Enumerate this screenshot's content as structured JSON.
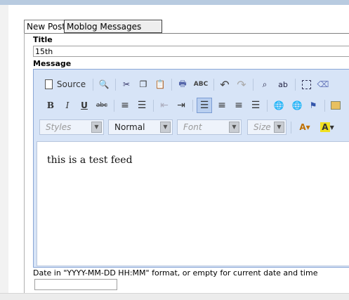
{
  "tabs": {
    "new_post": "New Post",
    "moblog": "Moblog Messages"
  },
  "form": {
    "title_label": "Title",
    "title_value": "15th",
    "message_label": "Message",
    "date_hint": "Date in \"YYYY-MM-DD HH:MM\" format, or empty for current date and time",
    "date_value": ""
  },
  "editor": {
    "source_label": "Source",
    "styles_placeholder": "Styles",
    "format_value": "Normal",
    "font_placeholder": "Font",
    "size_placeholder": "Size",
    "content": "this is a test feed"
  }
}
